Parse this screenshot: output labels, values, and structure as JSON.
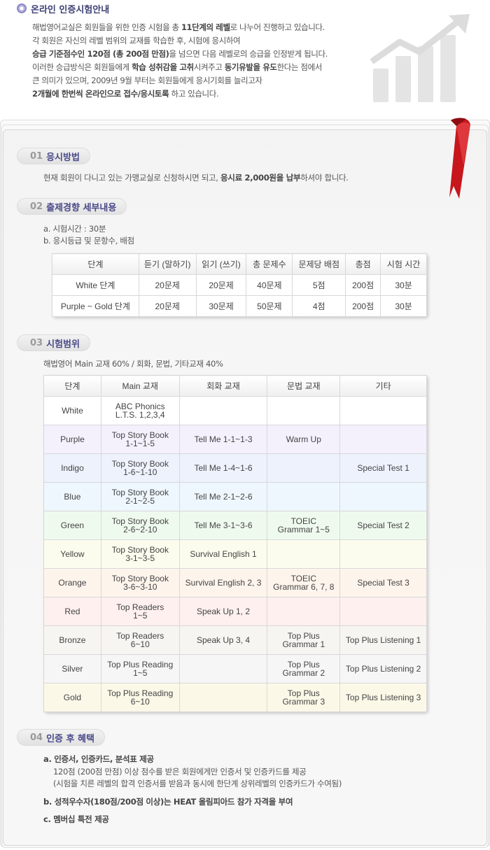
{
  "intro": {
    "title": "온라인 인증시험안내",
    "lines": [
      [
        {
          "t": "해법영어교실은 회원들을 위한 인증 시험을 총 "
        },
        {
          "t": "11단계의 레벨",
          "b": true
        },
        {
          "t": "로 나누어 진행하고 있습니다."
        }
      ],
      [
        {
          "t": "각 회원은 자신의 레벨 범위의 교재를 학습한 후,  시험에 응시하여"
        }
      ],
      [
        {
          "t": "승급 기준점수인 120점 (총 200점 만점)",
          "b": true
        },
        {
          "t": "을 넘으면 다음 레벨로의 승급을 인정받게 됩니다."
        }
      ],
      [
        {
          "t": "이러한 승급방식은 회원들에게 "
        },
        {
          "t": "학습 성취감을 고취",
          "b": true
        },
        {
          "t": "시켜주고 "
        },
        {
          "t": "동기유발을 유도",
          "b": true
        },
        {
          "t": "한다는 점에서"
        }
      ],
      [
        {
          "t": "큰 의미가 있으며,  2009년 9월 부터는 회원들에게 응시기회를 늘리고자"
        }
      ],
      [
        {
          "t": "2개월에 한번씩 온라인으로 접수/응시토록",
          "b": true
        },
        {
          "t": " 하고 있습니다."
        }
      ]
    ]
  },
  "sections": [
    {
      "num": "01",
      "title": "응시방법"
    },
    {
      "num": "02",
      "title": "출제경향 세부내용"
    },
    {
      "num": "03",
      "title": "시험범위"
    },
    {
      "num": "04",
      "title": "인증 후 혜택"
    }
  ],
  "s1": [
    {
      "t": "현재 회원이 다니고 있는 가맹교실로 신청하시면 되고, "
    },
    {
      "t": "응시료 2,000원을 납부",
      "b": true
    },
    {
      "t": "하셔야 합니다."
    }
  ],
  "s2": {
    "a": "a. 시험시간 : 30분",
    "b": "b. 응시등급 및 문항수, 배점",
    "headers": [
      "단계",
      "듣기 (말하기)",
      "읽기 (쓰기)",
      "총 문제수",
      "문제당 배점",
      "총점",
      "시험 시간"
    ],
    "rows": [
      [
        "White 단계",
        "20문제",
        "20문제",
        "40문제",
        "5점",
        "200점",
        "30분"
      ],
      [
        "Purple ~ Gold 단계",
        "20문제",
        "30문제",
        "50문제",
        "4점",
        "200점",
        "30분"
      ]
    ]
  },
  "s3": {
    "desc": "해법영어 Main 교재 60%  /  회화, 문법, 기타교재 40%",
    "headers": [
      "단계",
      "Main 교재",
      "회화 교재",
      "문법 교재",
      "기타"
    ],
    "rows": [
      {
        "bg": "#ffffff",
        "cells": [
          "White",
          "ABC Phonics\nL.T.S. 1,2,3,4",
          "",
          "",
          ""
        ]
      },
      {
        "bg": "#f4f1fd",
        "cells": [
          "Purple",
          "Top Story Book\n1-1~1-5",
          "Tell Me 1-1~1-3",
          "Warm Up",
          ""
        ]
      },
      {
        "bg": "#eef2fd",
        "cells": [
          "Indigo",
          "Top Story Book\n1-6~1-10",
          "Tell Me 1-4~1-6",
          "",
          "Special Test 1"
        ]
      },
      {
        "bg": "#eef7fd",
        "cells": [
          "Blue",
          "Top Story Book\n2-1~2-5",
          "Tell Me 2-1~2-6",
          "",
          ""
        ]
      },
      {
        "bg": "#effaef",
        "cells": [
          "Green",
          "Top Story Book\n2-6~2-10",
          "Tell Me 3-1~3-6",
          "TOEIC\nGrammar 1~5",
          "Special Test 2"
        ]
      },
      {
        "bg": "#fcfcee",
        "cells": [
          "Yellow",
          "Top Story Book\n3-1~3-5",
          "Survival English 1",
          "",
          ""
        ]
      },
      {
        "bg": "#fdf4ec",
        "cells": [
          "Orange",
          "Top Story Book\n3-6~3-10",
          "Survival English 2, 3",
          "TOEIC\nGrammar 6, 7, 8",
          "Special Test 3"
        ]
      },
      {
        "bg": "#fdf0ef",
        "cells": [
          "Red",
          "Top Readers\n1~5",
          "Speak Up 1, 2",
          "",
          ""
        ]
      },
      {
        "bg": "#f7f5f1",
        "cells": [
          "Bronze",
          "Top Readers\n6~10",
          "Speak Up 3, 4",
          "Top Plus\nGrammar 1",
          "Top Plus Listening 1"
        ]
      },
      {
        "bg": "#f6f6f6",
        "cells": [
          "Silver",
          "Top Plus Reading\n1~5",
          "",
          "Top Plus\nGrammar 2",
          "Top Plus Listening 2"
        ]
      },
      {
        "bg": "#fcf8e8",
        "cells": [
          "Gold",
          "Top Plus Reading\n6~10",
          "",
          "Top Plus\nGrammar 3",
          "Top Plus Listening 3"
        ]
      }
    ]
  },
  "s4": {
    "a_title": "a. 인증서, 인증카드, 분석표 제공",
    "a_line1": "120점 (200점 만점) 이상 점수를 받은 회원에게만 인증서 및 인증카드를 제공",
    "a_line2": "(시험을 치른 레벨의 합격 인증서를 받음과 동시에 한단계 상위레벨의 인증카드가 수여됨)",
    "b": "b. 성적우수자(180점/200점 이상)는 HEAT 올림피아드 참가 자격을 부여",
    "c": "c. 멤버십 특전 제공"
  },
  "colors": {
    "accent": "#4a4a8a",
    "ribbon": "#c8161d"
  }
}
